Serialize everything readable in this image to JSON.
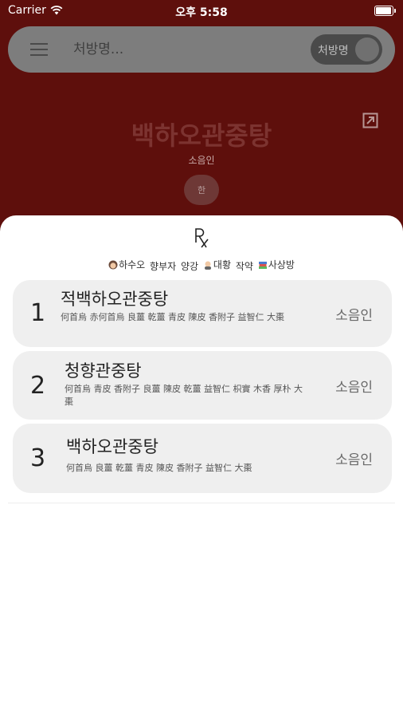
{
  "status_bar": {
    "carrier": "Carrier",
    "time": "오후 5:58",
    "battery_level": 0.95
  },
  "search": {
    "placeholder": "처방명...",
    "toggle_label": "처방명"
  },
  "header": {
    "title": "백하오관중탕",
    "subtitle": "소음인",
    "badge": "한"
  },
  "sheet": {
    "tags": [
      "하수오",
      "향부자",
      "양강",
      "대황",
      "작약",
      "사상방"
    ],
    "results": [
      {
        "rank": "1",
        "name": "적백하오관중탕",
        "herbs": "何首烏 赤何首烏 良薑 乾薑 青皮 陳皮 香附子 益智仁 大棗",
        "source": "소음인"
      },
      {
        "rank": "2",
        "name": "청향관중탕",
        "herbs": "何首烏 青皮 香附子 良薑 陳皮 乾薑 益智仁 枳實 木香 厚朴 大棗",
        "source": "소음인"
      },
      {
        "rank": "3",
        "name": "백하오관중탕",
        "herbs": "何首烏 良薑 乾薑 青皮 陳皮 香附子 益智仁 大棗",
        "source": "소음인"
      }
    ]
  },
  "colors": {
    "background": "#5e0f0c",
    "search_bar": "#7d7d7d",
    "card": "#efefef",
    "sheet": "#ffffff"
  }
}
